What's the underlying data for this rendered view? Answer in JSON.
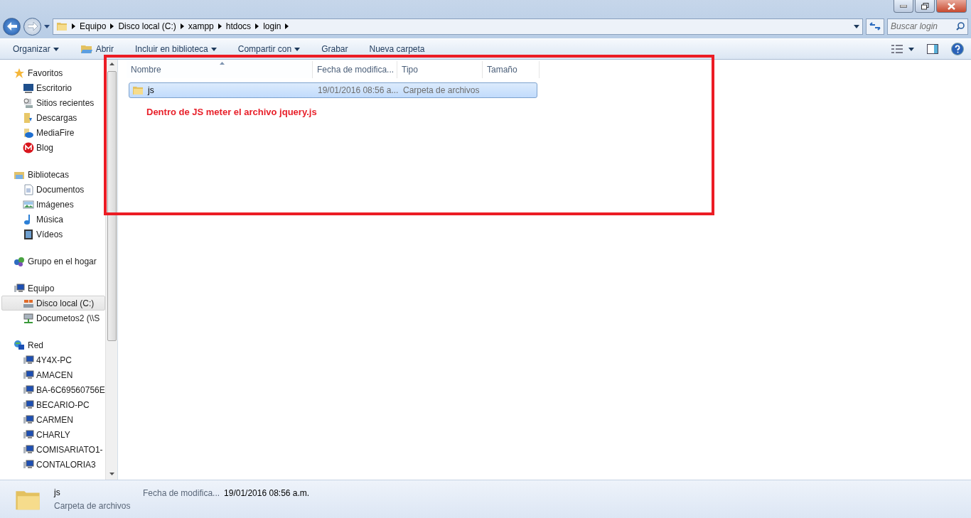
{
  "address": {
    "crumbs": [
      "Equipo",
      "Disco local (C:)",
      "xampp",
      "htdocs",
      "login"
    ],
    "search_placeholder": "Buscar login"
  },
  "toolbar": [
    {
      "label": "Organizar",
      "kind": "menu"
    },
    {
      "label": "Abrir",
      "kind": "open"
    },
    {
      "label": "Incluir en biblioteca",
      "kind": "menu"
    },
    {
      "label": "Compartir con",
      "kind": "menu"
    },
    {
      "label": "Grabar",
      "kind": "plain"
    },
    {
      "label": "Nueva carpeta",
      "kind": "plain"
    }
  ],
  "sidebar": [
    {
      "label": "Favoritos",
      "kind": "star",
      "children": [
        {
          "label": "Escritorio",
          "kind": "desktop",
          "selected": false
        },
        {
          "label": "Sitios recientes",
          "kind": "recent",
          "selected": false
        },
        {
          "label": "Descargas",
          "kind": "downloads",
          "selected": false
        },
        {
          "label": "MediaFire",
          "kind": "mediafire",
          "selected": false
        },
        {
          "label": "Blog",
          "kind": "blog",
          "selected": false
        }
      ]
    },
    {
      "label": "Bibliotecas",
      "kind": "library",
      "children": [
        {
          "label": "Documentos",
          "kind": "document",
          "selected": false
        },
        {
          "label": "Imágenes",
          "kind": "pictures",
          "selected": false
        },
        {
          "label": "Música",
          "kind": "music",
          "selected": false
        },
        {
          "label": "Vídeos",
          "kind": "video",
          "selected": false
        }
      ]
    },
    {
      "label": "Grupo en el hogar",
      "kind": "homegroup"
    },
    {
      "label": "Equipo",
      "kind": "computer",
      "children": [
        {
          "label": "Disco local (C:)",
          "kind": "drive",
          "selected": true
        },
        {
          "label": "Documetos2 (\\\\S",
          "kind": "netdrive",
          "selected": false
        }
      ]
    },
    {
      "label": "Red",
      "kind": "network",
      "children": [
        {
          "label": "4Y4X-PC",
          "kind": "computer",
          "selected": false
        },
        {
          "label": "AMACEN",
          "kind": "computer",
          "selected": false
        },
        {
          "label": "BA-6C69560756E",
          "kind": "computer",
          "selected": false
        },
        {
          "label": "BECARIO-PC",
          "kind": "computer",
          "selected": false
        },
        {
          "label": "CARMEN",
          "kind": "computer",
          "selected": false
        },
        {
          "label": "CHARLY",
          "kind": "computer",
          "selected": false
        },
        {
          "label": "COMISARIATO1-",
          "kind": "computer",
          "selected": false
        },
        {
          "label": "CONTALORIA3",
          "kind": "computer",
          "selected": false
        }
      ]
    }
  ],
  "columns": [
    {
      "label": "Nombre",
      "sorted": true
    },
    {
      "label": "Fecha de modifica...",
      "sorted": false
    },
    {
      "label": "Tipo",
      "sorted": false
    },
    {
      "label": "Tamaño",
      "sorted": false
    }
  ],
  "rows": [
    {
      "name": "js",
      "date": "19/01/2016 08:56 a...",
      "type": "Carpeta de archivos",
      "selected": true
    }
  ],
  "annotation": {
    "text": "Dentro de JS meter el archivo jquery.js"
  },
  "details": {
    "name": "js",
    "type": "Carpeta de archivos",
    "field_label": "Fecha de modifica...",
    "field_value": "19/01/2016 08:56 a.m."
  }
}
